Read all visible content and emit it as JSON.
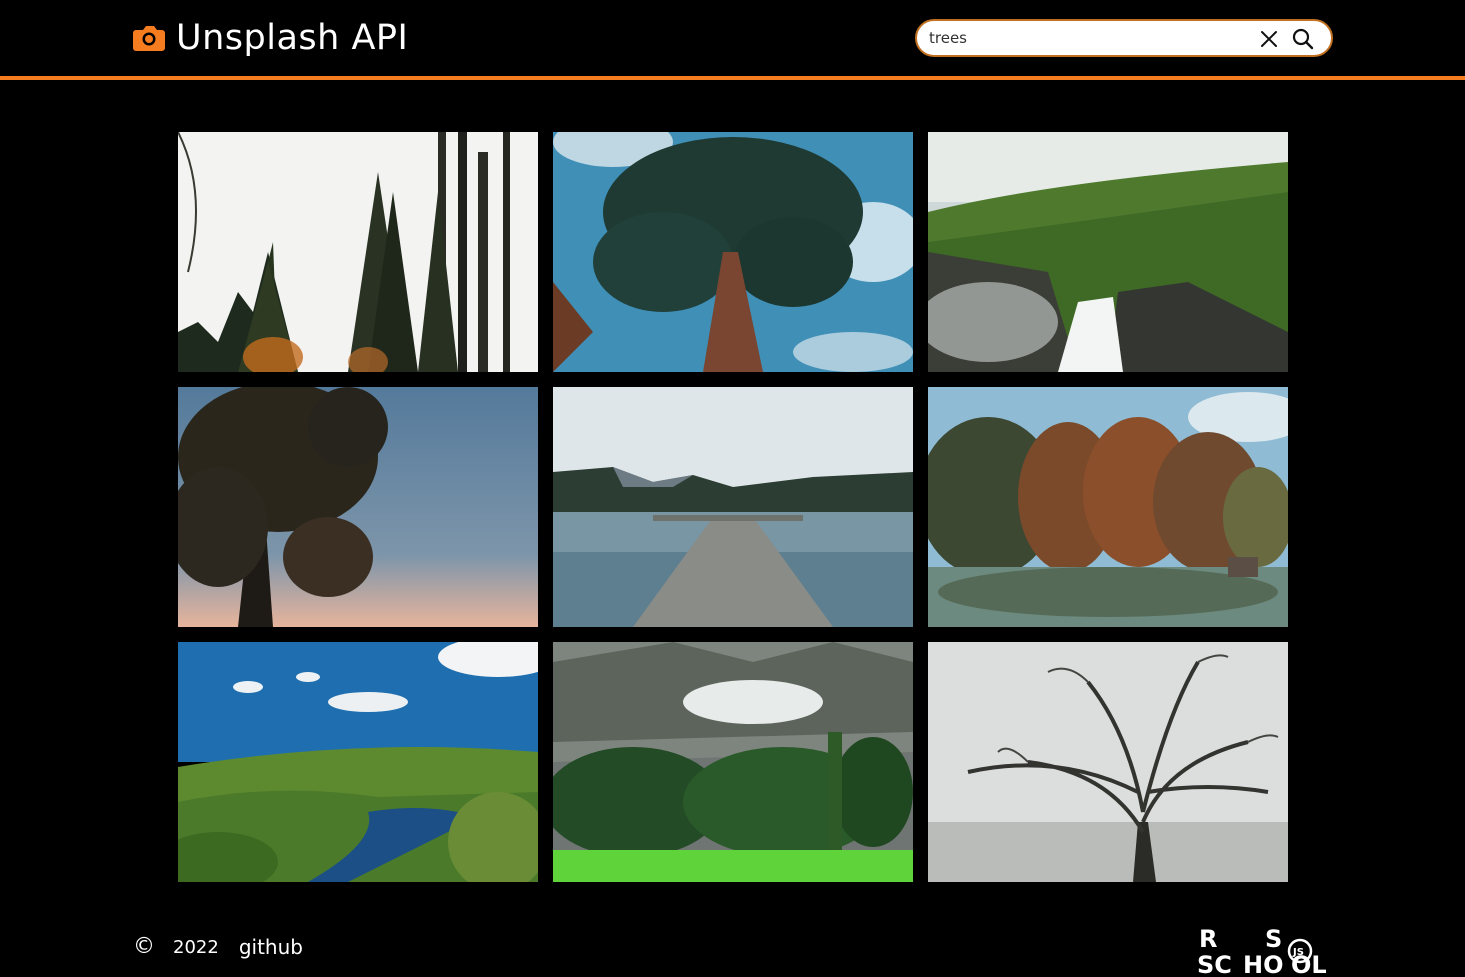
{
  "header": {
    "title": "Unsplash API",
    "logo_icon": "camera-icon",
    "accent_color": "#f57c1f"
  },
  "search": {
    "value": "trees",
    "clear_icon": "close-icon",
    "submit_icon": "search-icon"
  },
  "gallery": {
    "photos": [
      {
        "subject": "tall pine trees against white sky"
      },
      {
        "subject": "looking up at large tree and blue sky"
      },
      {
        "subject": "waterfall and green forest"
      },
      {
        "subject": "tree silhouette against dusk sky"
      },
      {
        "subject": "wooden pier on misty lake"
      },
      {
        "subject": "autumn trees reflected in lake"
      },
      {
        "subject": "river winding through forested hills"
      },
      {
        "subject": "green meadow with forest and mountain"
      },
      {
        "subject": "bare tree in fog"
      }
    ]
  },
  "footer": {
    "copyright_symbol": "©",
    "year": "2022",
    "github_label": "github",
    "school_logo": {
      "line1_left": "R",
      "line1_right": "S",
      "line2_left": "SC",
      "line2_mid": "HO",
      "line2_right": "OL",
      "badge": "JS"
    }
  }
}
